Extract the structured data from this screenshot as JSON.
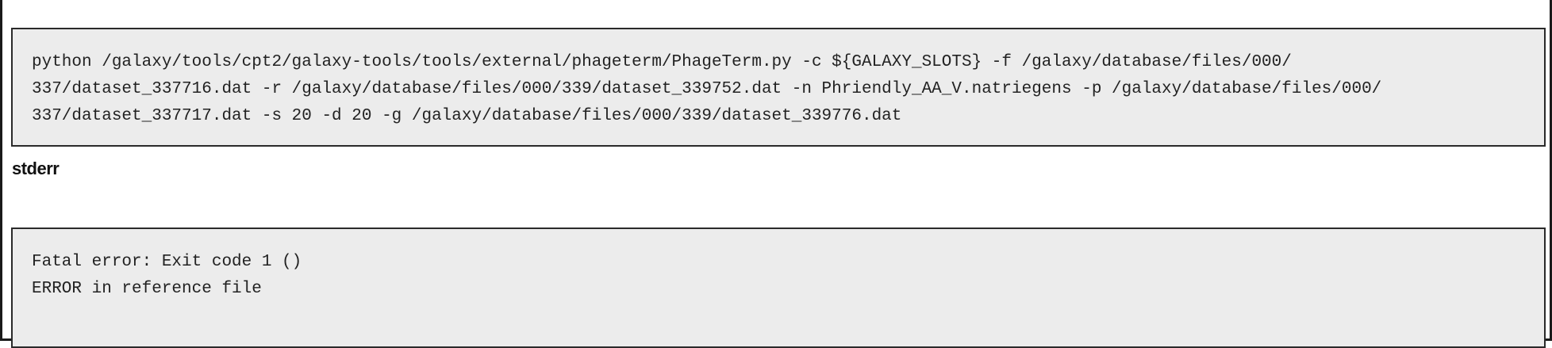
{
  "command": {
    "lines": [
      "python /galaxy/tools/cpt2/galaxy-tools/tools/external/phageterm/PhageTerm.py -c ${GALAXY_SLOTS} -f /galaxy/database/files/000/",
      "337/dataset_337716.dat -r /galaxy/database/files/000/339/dataset_339752.dat -n Phriendly_AA_V.natriegens -p /galaxy/database/files/000/",
      "337/dataset_337717.dat -s 20 -d 20 -g /galaxy/database/files/000/339/dataset_339776.dat"
    ]
  },
  "stderr": {
    "heading": "stderr",
    "lines": [
      "Fatal error: Exit code 1 ()",
      "ERROR in reference file"
    ]
  }
}
